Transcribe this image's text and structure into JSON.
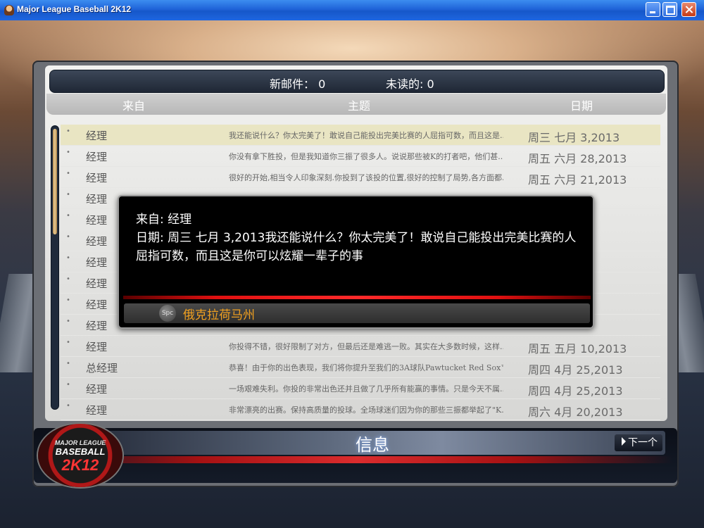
{
  "window": {
    "title": "Major League Baseball 2K12"
  },
  "mailbar": {
    "new_mail": "新邮件： 0",
    "unread": "未读的: 0"
  },
  "columns": {
    "from": "来自",
    "subject": "主题",
    "date": "日期"
  },
  "messages": [
    {
      "from": "经理",
      "subject": "我还能说什么？你太完美了！敢说自己能投出完美比赛的人屈指可数，而且这是...",
      "date": "周三 七月 3,2013"
    },
    {
      "from": "经理",
      "subject": "你没有拿下胜投，但是我知道你三振了很多人。说说那些被K的打者吧，他们甚...",
      "date": "周五 六月 28,2013"
    },
    {
      "from": "经理",
      "subject": "很好的开始,相当令人印象深刻.你投到了该投的位置,很好的控制了局势,各方面都...",
      "date": "周五 六月 21,2013"
    },
    {
      "from": "经理",
      "subject": "",
      "date": ""
    },
    {
      "from": "经理",
      "subject": "",
      "date": ""
    },
    {
      "from": "经理",
      "subject": "",
      "date": ""
    },
    {
      "from": "经理",
      "subject": "",
      "date": ""
    },
    {
      "from": "经理",
      "subject": "",
      "date": ""
    },
    {
      "from": "经理",
      "subject": "",
      "date": ""
    },
    {
      "from": "经理",
      "subject": "",
      "date": ""
    },
    {
      "from": "经理",
      "subject": "你投得不错，很好限制了对方，但最后还是难逃一败。其实在大多数时候，这样...",
      "date": "周五 五月 10,2013"
    },
    {
      "from": "总经理",
      "subject": "恭喜！由于你的出色表现，我们将你提升至我们的3A球队Pawtucket Red Sox™...",
      "date": "周四 4月 25,2013"
    },
    {
      "from": "经理",
      "subject": "一场艰难失利。你投的非常出色还并且做了几乎所有能赢的事情。只是今天不属...",
      "date": "周四 4月 25,2013"
    },
    {
      "from": "经理",
      "subject": "非常漂亮的出赛。保持高质量的投球。全场球迷们因为你的那些三振都举起了\"K...",
      "date": "周六 4月 20,2013"
    }
  ],
  "popup": {
    "from_line": "来自: 经理",
    "body": "日期: 周三 七月 3,2013我还能说什么？你太完美了！敢说自己能投出完美比赛的人屈指可数，而且这是你可以炫耀一辈子的事",
    "key_label": "Spc",
    "footer_label": "俄克拉荷马州"
  },
  "bottom": {
    "title": "信息",
    "next_label": "下一个"
  },
  "logo": {
    "line1": "MAJOR LEAGUE",
    "line2": "BASEBALL",
    "line3": "2K12"
  },
  "colors": {
    "selected_row": "#e9e5c3",
    "footer_text": "#f0a020",
    "accent_red": "#e01010"
  }
}
